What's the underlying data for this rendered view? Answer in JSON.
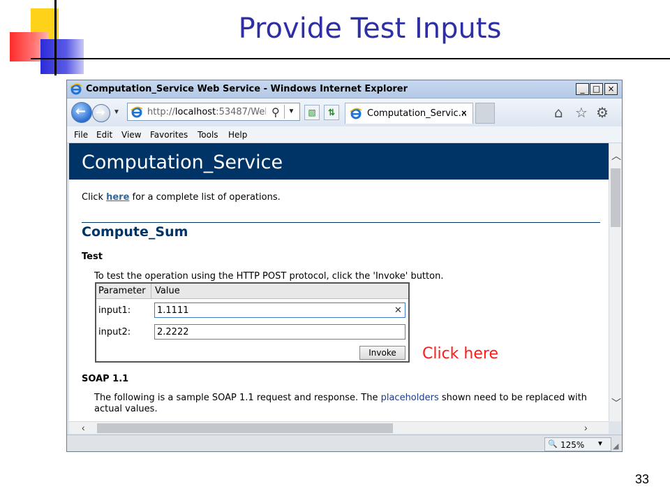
{
  "slide": {
    "title": "Provide Test Inputs",
    "page_number": "33",
    "click_note": "Click here"
  },
  "window": {
    "title": "Computation_Service Web Service - Windows Internet Explorer",
    "min_symbol": "_",
    "max_symbol": "□",
    "close_symbol": "×"
  },
  "address": {
    "scheme": "http://",
    "host": "localhost",
    "rest": ":53487/Web_"
  },
  "tab": {
    "label": "Computation_Servic...",
    "close_symbol": "×"
  },
  "menu": [
    "File",
    "Edit",
    "View",
    "Favorites",
    "Tools",
    "Help"
  ],
  "page": {
    "heading": "Computation_Service",
    "intro_prefix": "Click ",
    "intro_link": "here",
    "intro_suffix": " for a complete list of operations.",
    "operation": "Compute_Sum",
    "test_heading": "Test",
    "test_desc": "To test the operation using the HTTP POST protocol, click the 'Invoke' button.",
    "table": {
      "col_parameter": "Parameter",
      "col_value": "Value",
      "rows": [
        {
          "label": "input1:",
          "value": "1.1111"
        },
        {
          "label": "input2:",
          "value": "2.2222"
        }
      ]
    },
    "invoke_label": "Invoke",
    "soap_heading": "SOAP 1.1",
    "soap_desc_prefix": "The following is a sample SOAP 1.1 request and response. The ",
    "soap_desc_link": "placeholders",
    "soap_desc_suffix": " shown need to be replaced with actual values."
  },
  "status": {
    "zoom": "125%"
  },
  "icons": {
    "back": "back-arrow-icon",
    "forward": "forward-arrow-icon",
    "search": "search-icon",
    "home": "home-icon",
    "favorites": "star-icon",
    "tools": "gear-icon"
  },
  "colors": {
    "title": "#2e2ea6",
    "header_band": "#003366",
    "click_note": "#ff1a1a",
    "link": "#336699"
  }
}
